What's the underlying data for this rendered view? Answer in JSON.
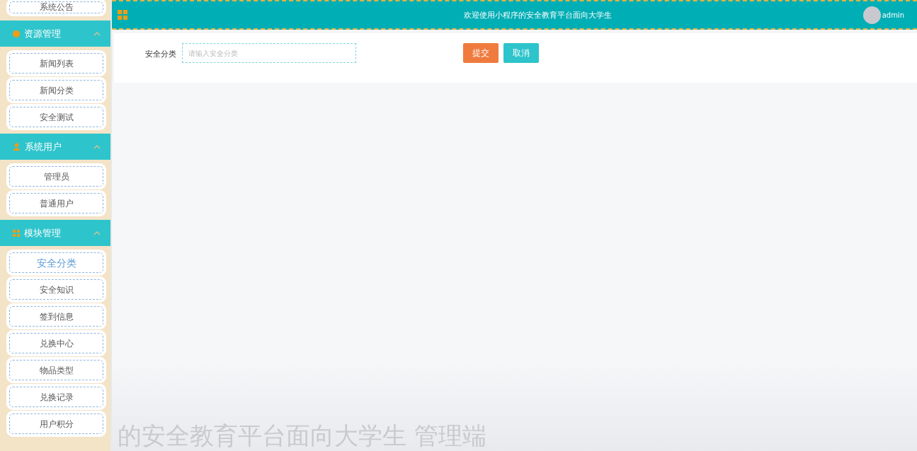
{
  "sidebar": {
    "top_item": {
      "label": "系统公告",
      "selected": false
    },
    "groups": [
      {
        "title": "资源管理",
        "kind": "dot",
        "expanded": true,
        "items": [
          {
            "label": "新闻列表",
            "selected": false
          },
          {
            "label": "新闻分类",
            "selected": false
          },
          {
            "label": "安全测试",
            "selected": false
          }
        ]
      },
      {
        "title": "系统用户",
        "kind": "person",
        "expanded": true,
        "items": [
          {
            "label": "管理员",
            "selected": false
          },
          {
            "label": "普通用户",
            "selected": false
          }
        ]
      },
      {
        "title": "模块管理",
        "kind": "grid",
        "expanded": true,
        "items": [
          {
            "label": "安全分类",
            "selected": true
          },
          {
            "label": "安全知识",
            "selected": false
          },
          {
            "label": "签到信息",
            "selected": false
          },
          {
            "label": "兑换中心",
            "selected": false
          },
          {
            "label": "物品类型",
            "selected": false
          },
          {
            "label": "兑换记录",
            "selected": false
          },
          {
            "label": "用户积分",
            "selected": false
          }
        ]
      }
    ]
  },
  "header": {
    "title": "欢迎使用小程序的安全教育平台面向大学生",
    "user": "admin"
  },
  "form": {
    "label": "安全分类",
    "placeholder": "请输入安全分类",
    "buttons": [
      {
        "label": "提交",
        "kind": "primary"
      },
      {
        "label": "取消",
        "kind": "secondary"
      }
    ]
  },
  "background_title": "的安全教育平台面向大学生 管理端"
}
